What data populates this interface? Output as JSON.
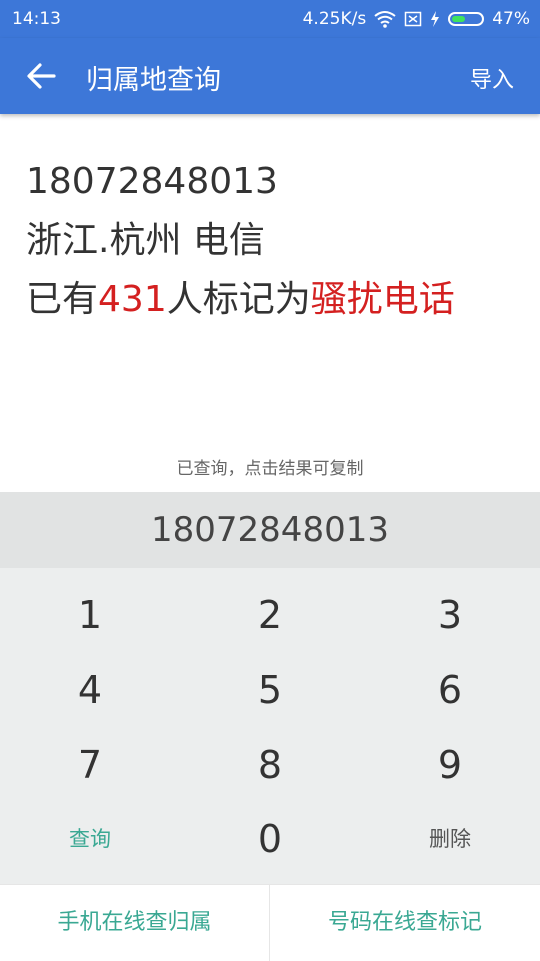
{
  "status": {
    "time": "14:13",
    "speed": "4.25K/s",
    "battery": "47%",
    "battery_level": 0.47
  },
  "appbar": {
    "title": "归属地查询",
    "import_label": "导入"
  },
  "result": {
    "number": "18072848013",
    "location": "浙江.杭州 电信",
    "prefix": "已有",
    "count": "431",
    "middle": "人标记为",
    "tag": "骚扰电话"
  },
  "hint": "已查询，点击结果可复制",
  "display_number": "18072848013",
  "keypad": {
    "k1": "1",
    "k2": "2",
    "k3": "3",
    "k4": "4",
    "k5": "5",
    "k6": "6",
    "k7": "7",
    "k8": "8",
    "k9": "9",
    "query": "查询",
    "k0": "0",
    "delete": "删除"
  },
  "bottom": {
    "left": "手机在线查归属",
    "right": "号码在线查标记"
  },
  "colors": {
    "primary": "#3d77d8",
    "accent": "#3aa893",
    "highlight": "#d42020"
  }
}
